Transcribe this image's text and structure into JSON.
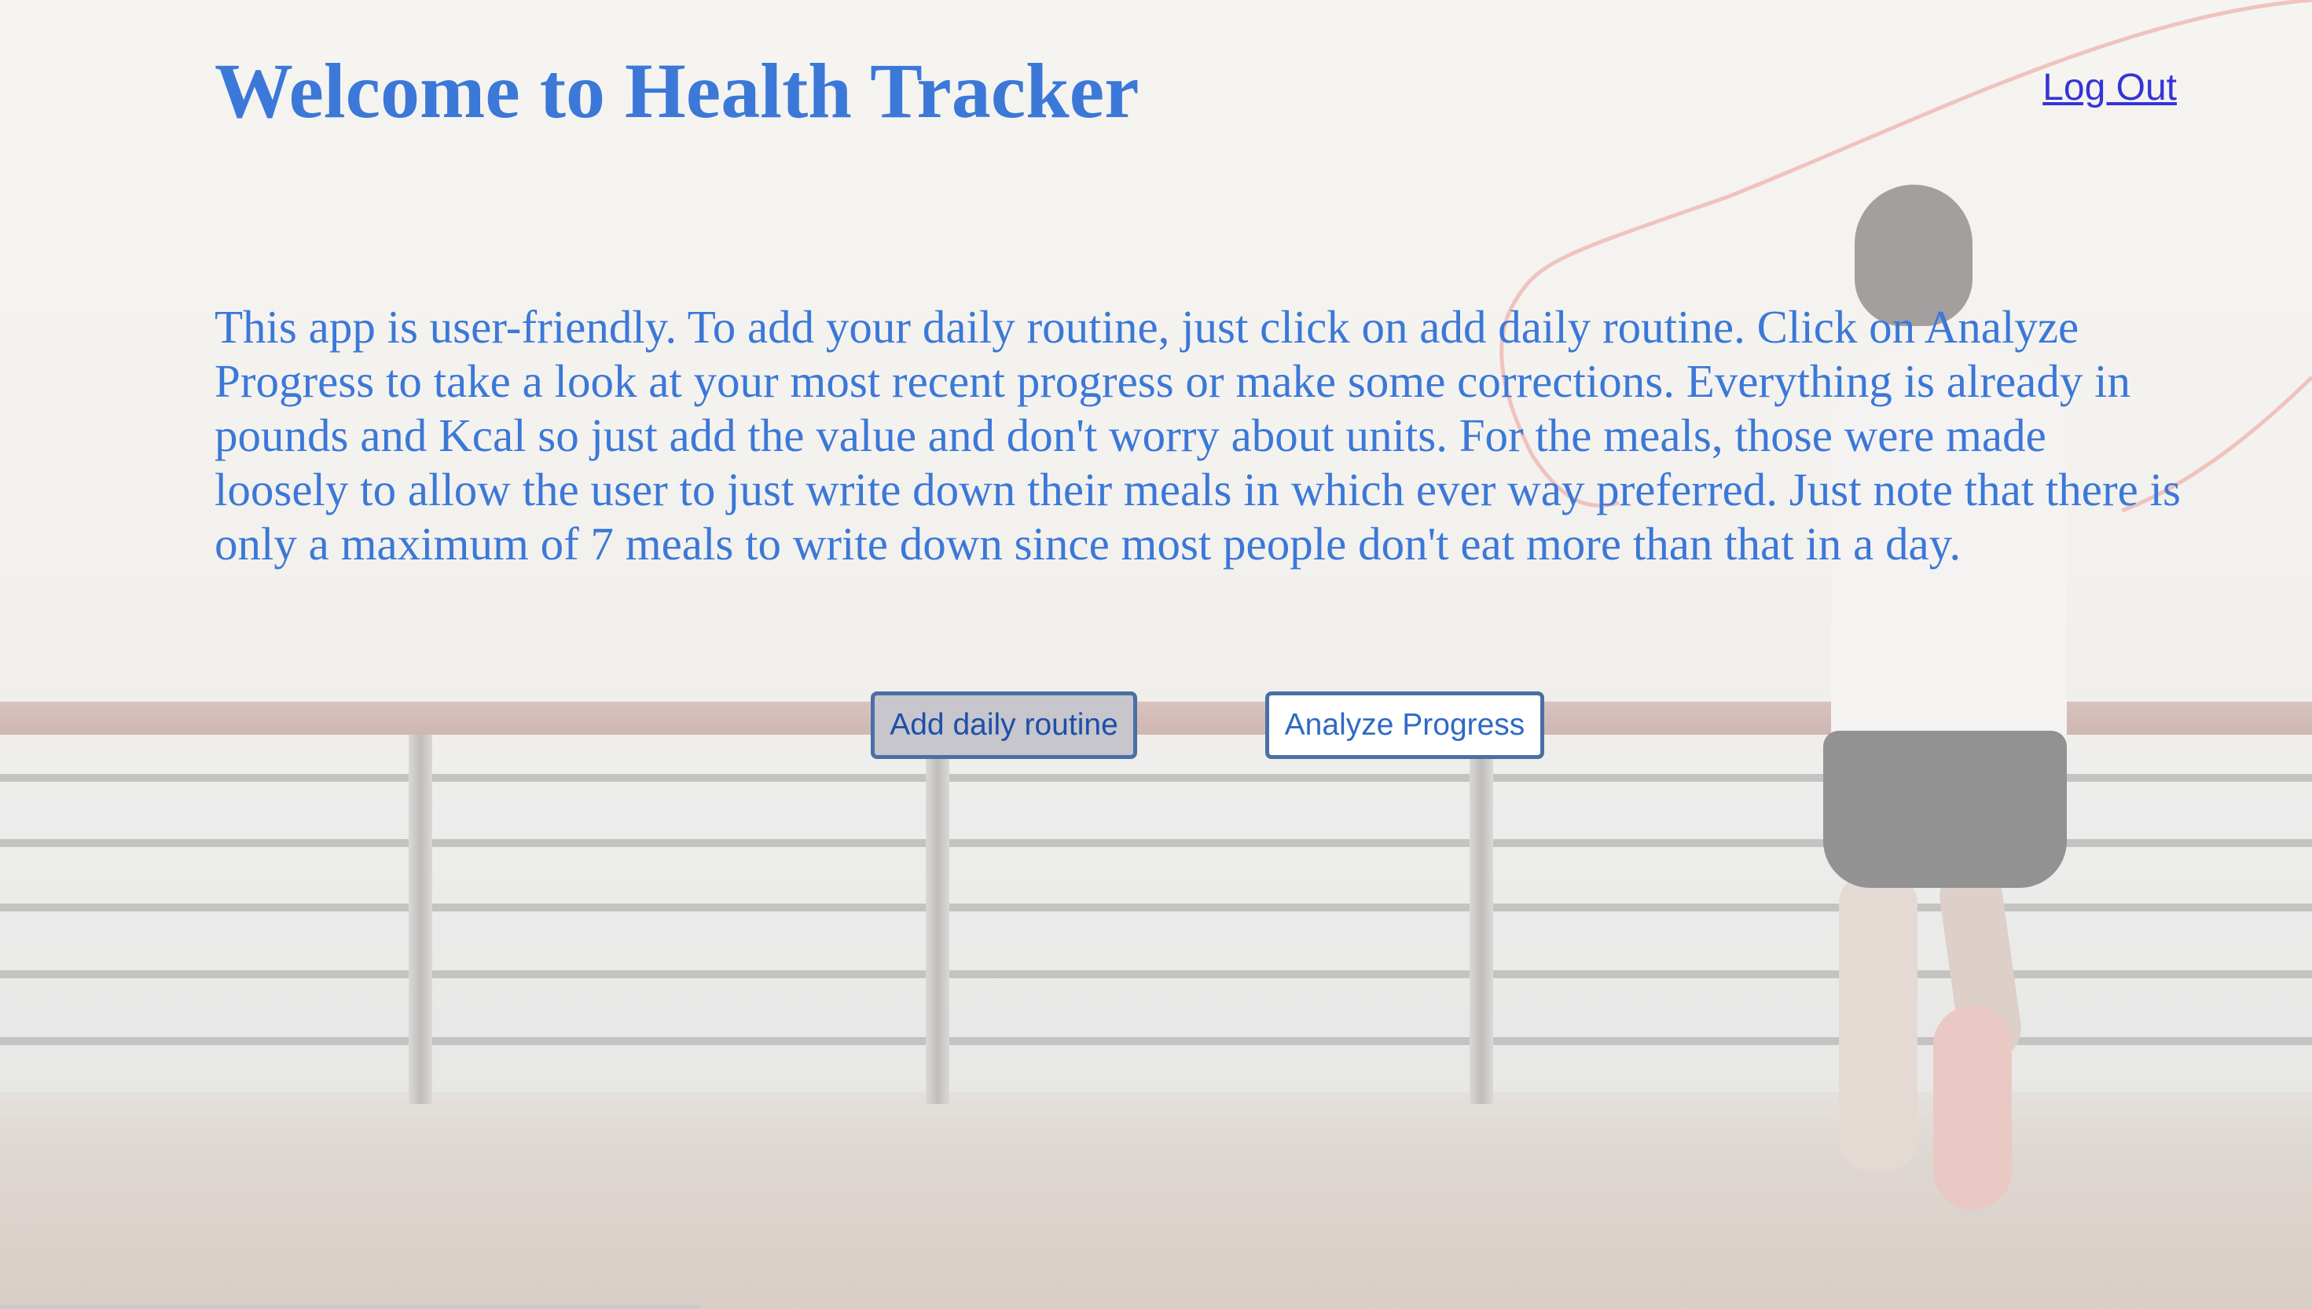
{
  "header": {
    "title": "Welcome to Health Tracker",
    "logout_label": "Log Out"
  },
  "main": {
    "intro": "This app is user-friendly. To add your daily routine, just click on add daily routine. Click on Analyze Progress to take a look at your most recent progress or make some corrections. Everything is already in pounds and Kcal so just add the value and don't worry about units. For the meals, those were made loosely to allow the user to just write down their meals in which ever way preferred. Just note that there is only a maximum of 7 meals to write down since most people don't eat more than that in a day.",
    "buttons": {
      "add_routine": "Add daily routine",
      "analyze_progress": "Analyze Progress"
    }
  },
  "colors": {
    "title": "#3b78d8",
    "link": "#3434d6",
    "button_border": "#4a6fa5"
  }
}
